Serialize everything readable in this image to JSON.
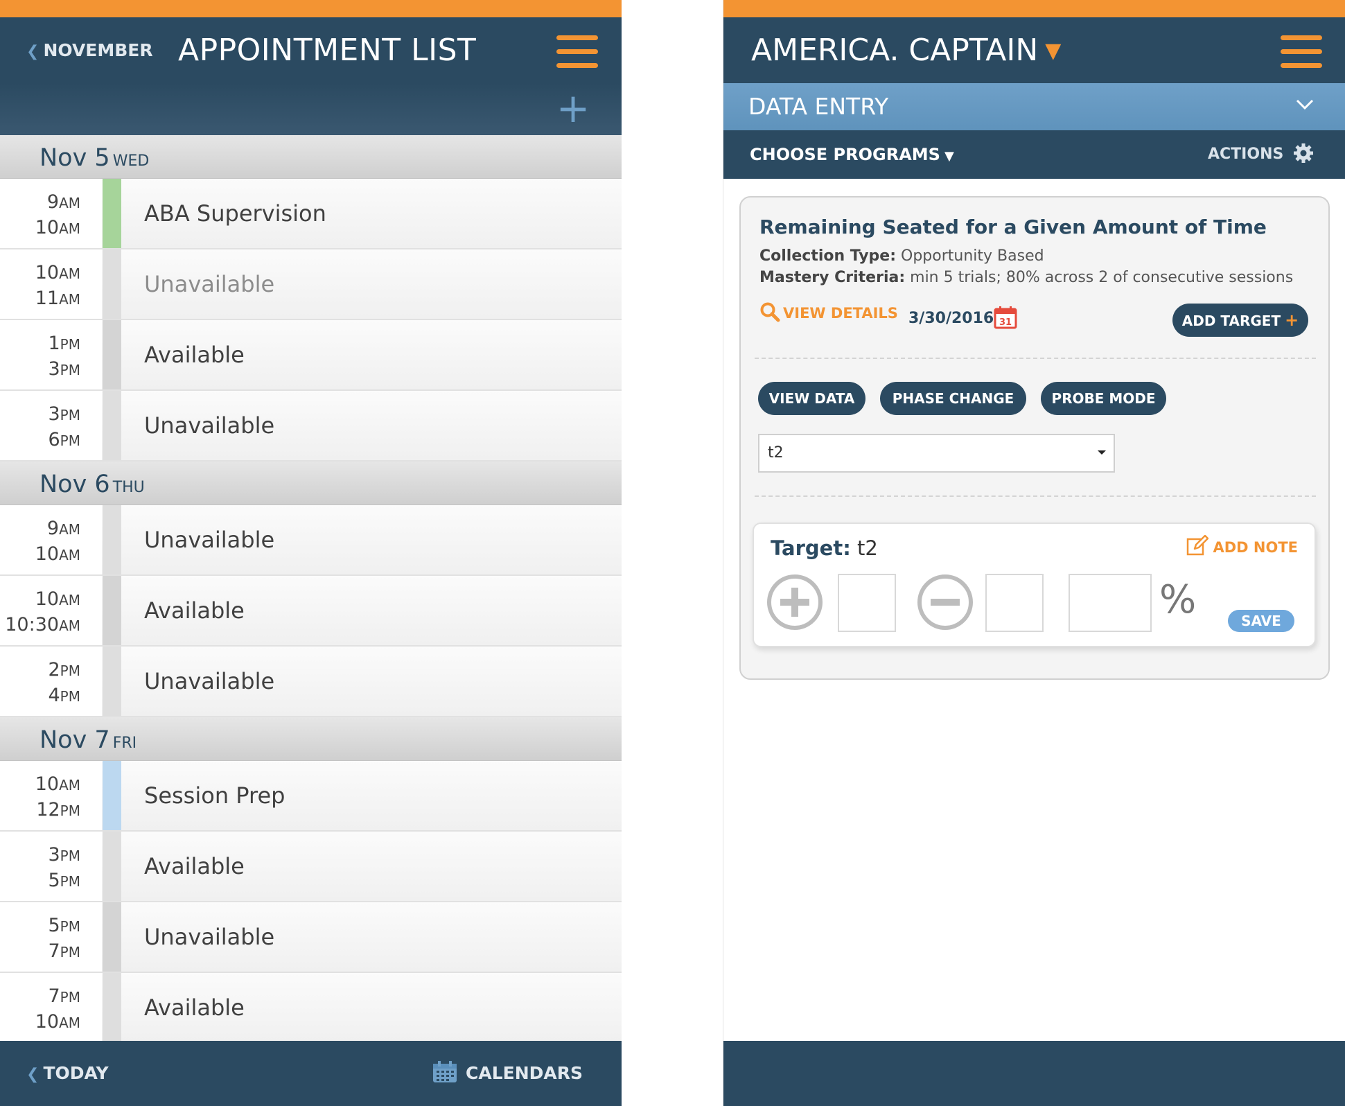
{
  "colors": {
    "orange": "#f39433",
    "navy": "#2b4a61",
    "light_blue": "#6fa0c8",
    "green_marker": "#a6d49a",
    "blue_marker": "#bcd8f0"
  },
  "appointments_screen": {
    "back_label": "NOVEMBER",
    "title": "APPOINTMENT LIST",
    "add_icon": "plus-icon",
    "days": [
      {
        "date": "Nov 5",
        "dow": "WED",
        "slots": [
          {
            "start": "9",
            "start_ap": "AM",
            "end": "10",
            "end_ap": "AM",
            "title": "ABA Supervision",
            "marker": "green"
          },
          {
            "start": "10",
            "start_ap": "AM",
            "end": "11",
            "end_ap": "AM",
            "title": "Unavailable",
            "marker": "none"
          },
          {
            "start": "1",
            "start_ap": "PM",
            "end": "3",
            "end_ap": "PM",
            "title": "Available",
            "marker": "gray"
          },
          {
            "start": "3",
            "start_ap": "PM",
            "end": "6",
            "end_ap": "PM",
            "title": "Unavailable",
            "marker": "none"
          }
        ]
      },
      {
        "date": "Nov 6",
        "dow": "THU",
        "slots": [
          {
            "start": "9",
            "start_ap": "AM",
            "end": "10",
            "end_ap": "AM",
            "title": "Unavailable",
            "marker": "none"
          },
          {
            "start": "10",
            "start_ap": "AM",
            "end": "10:30",
            "end_ap": "AM",
            "title": "Available",
            "marker": "gray"
          },
          {
            "start": "2",
            "start_ap": "PM",
            "end": "4",
            "end_ap": "PM",
            "title": "Unavailable",
            "marker": "none"
          }
        ]
      },
      {
        "date": "Nov 7",
        "dow": "FRI",
        "slots": [
          {
            "start": "10",
            "start_ap": "AM",
            "end": "12",
            "end_ap": "PM",
            "title": "Session Prep",
            "marker": "blue"
          },
          {
            "start": "3",
            "start_ap": "PM",
            "end": "5",
            "end_ap": "PM",
            "title": "Available",
            "marker": "none"
          },
          {
            "start": "5",
            "start_ap": "PM",
            "end": "7",
            "end_ap": "PM",
            "title": "Unavailable",
            "marker": "gray"
          },
          {
            "start": "7",
            "start_ap": "PM",
            "end": "10",
            "end_ap": "AM",
            "title": "Available",
            "marker": "none"
          }
        ]
      }
    ],
    "footer": {
      "today_label": "TODAY",
      "calendars_label": "CALENDARS",
      "calendars_icon": "calendar-icon"
    }
  },
  "data_entry_screen": {
    "client_name": "AMERICA. CAPTAIN",
    "section_label": "DATA ENTRY",
    "choose_programs_label": "CHOOSE PROGRAMS",
    "actions_label": "ACTIONS",
    "actions_icon": "gear-icon",
    "program": {
      "title": "Remaining Seated for a Given Amount of Time",
      "collection_type_label": "Collection Type:",
      "collection_type_value": "Opportunity Based",
      "mastery_label": "Mastery Criteria:",
      "mastery_value": "min 5 trials; 80% across 2 of consecutive sessions",
      "view_details_label": "VIEW DETAILS",
      "date": "3/30/2016",
      "date_icon_day": "31",
      "add_target_label": "ADD TARGET",
      "buttons": [
        "VIEW DATA",
        "PHASE CHANGE",
        "PROBE MODE"
      ],
      "selected_target": "t2"
    },
    "target_card": {
      "label": "Target:",
      "value": "t2",
      "add_note_label": "ADD NOTE",
      "percent_symbol": "%",
      "save_label": "SAVE",
      "plus_count": "",
      "minus_count": "",
      "percent_value": ""
    }
  }
}
